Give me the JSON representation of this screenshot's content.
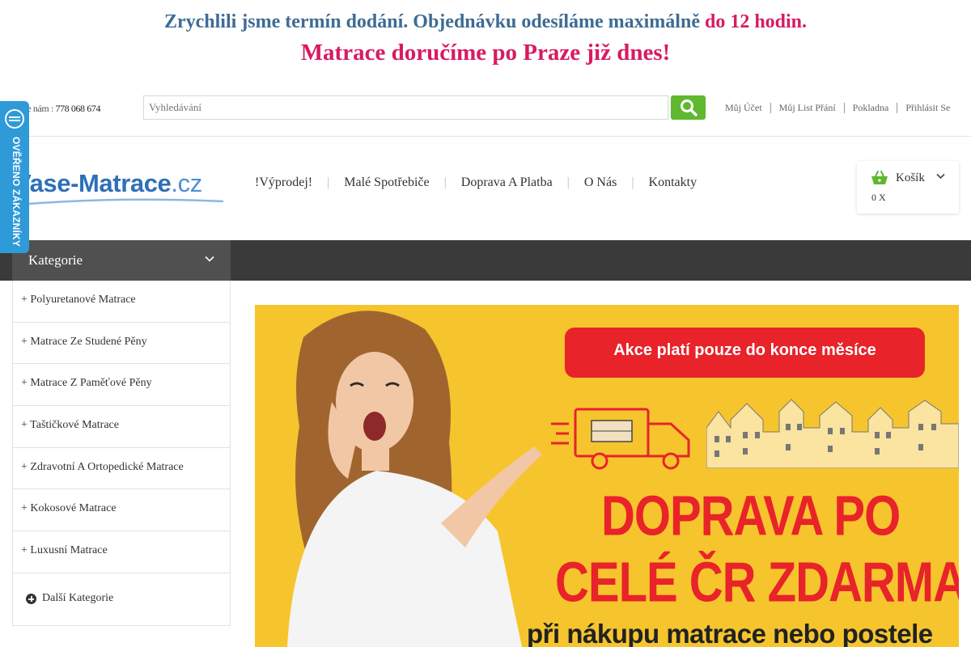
{
  "announcement": {
    "line1_main": "Zrychlili jsme termín dodání. Objednávku odesíláme maximálně ",
    "line1_highlight": "do 12 hodin.",
    "line2": "Matrace doručíme po Praze již dnes!"
  },
  "topbar": {
    "phone_label": "olejte nám : ",
    "phone_number": "778 068 674",
    "search_placeholder": "Vyhledávání",
    "links": [
      "Můj Účet",
      "Můj List Přání",
      "Pokladna",
      "Přihlásit Se"
    ]
  },
  "badge": {
    "text": "OVĚŘENO ZÁKAZNÍKY"
  },
  "logo": {
    "name": "Vase-Matrace",
    "tld": ".cz"
  },
  "nav": {
    "items": [
      "!Výprodej!",
      "Malé Spotřebiče",
      "Doprava A Platba",
      "O Nás",
      "Kontakty"
    ],
    "separator": "|"
  },
  "cart": {
    "label": "Košík",
    "count": "0 X"
  },
  "categories": {
    "title": "Kategorie",
    "plus": "+",
    "items": [
      "Polyuretanové Matrace",
      "Matrace Ze Studené Pěny",
      "Matrace Z Paměťové Pěny",
      "Taštičkové Matrace",
      "Zdravotní A Ortopedické Matrace",
      "Kokosové Matrace",
      "Luxusní Matrace"
    ],
    "more_label": "Další Kategorie"
  },
  "banner": {
    "pill_text": "Akce platí pouze do konce měsíce",
    "headline_1": "DOPRAVA PO",
    "headline_2": "CELÉ ČR ZDARMA",
    "subline": "při nákupu matrace nebo postele"
  },
  "colors": {
    "blue_text": "#3e6b94",
    "pink_text": "#d81b60",
    "search_green": "#5fb82e",
    "badge_blue": "#2e9ad8",
    "banner_yellow": "#f6c52d",
    "banner_red": "#e8232a"
  },
  "icons": [
    "search-icon",
    "basket-icon",
    "chevron-down-icon",
    "plus-circle-icon",
    "verified-seal-icon"
  ]
}
